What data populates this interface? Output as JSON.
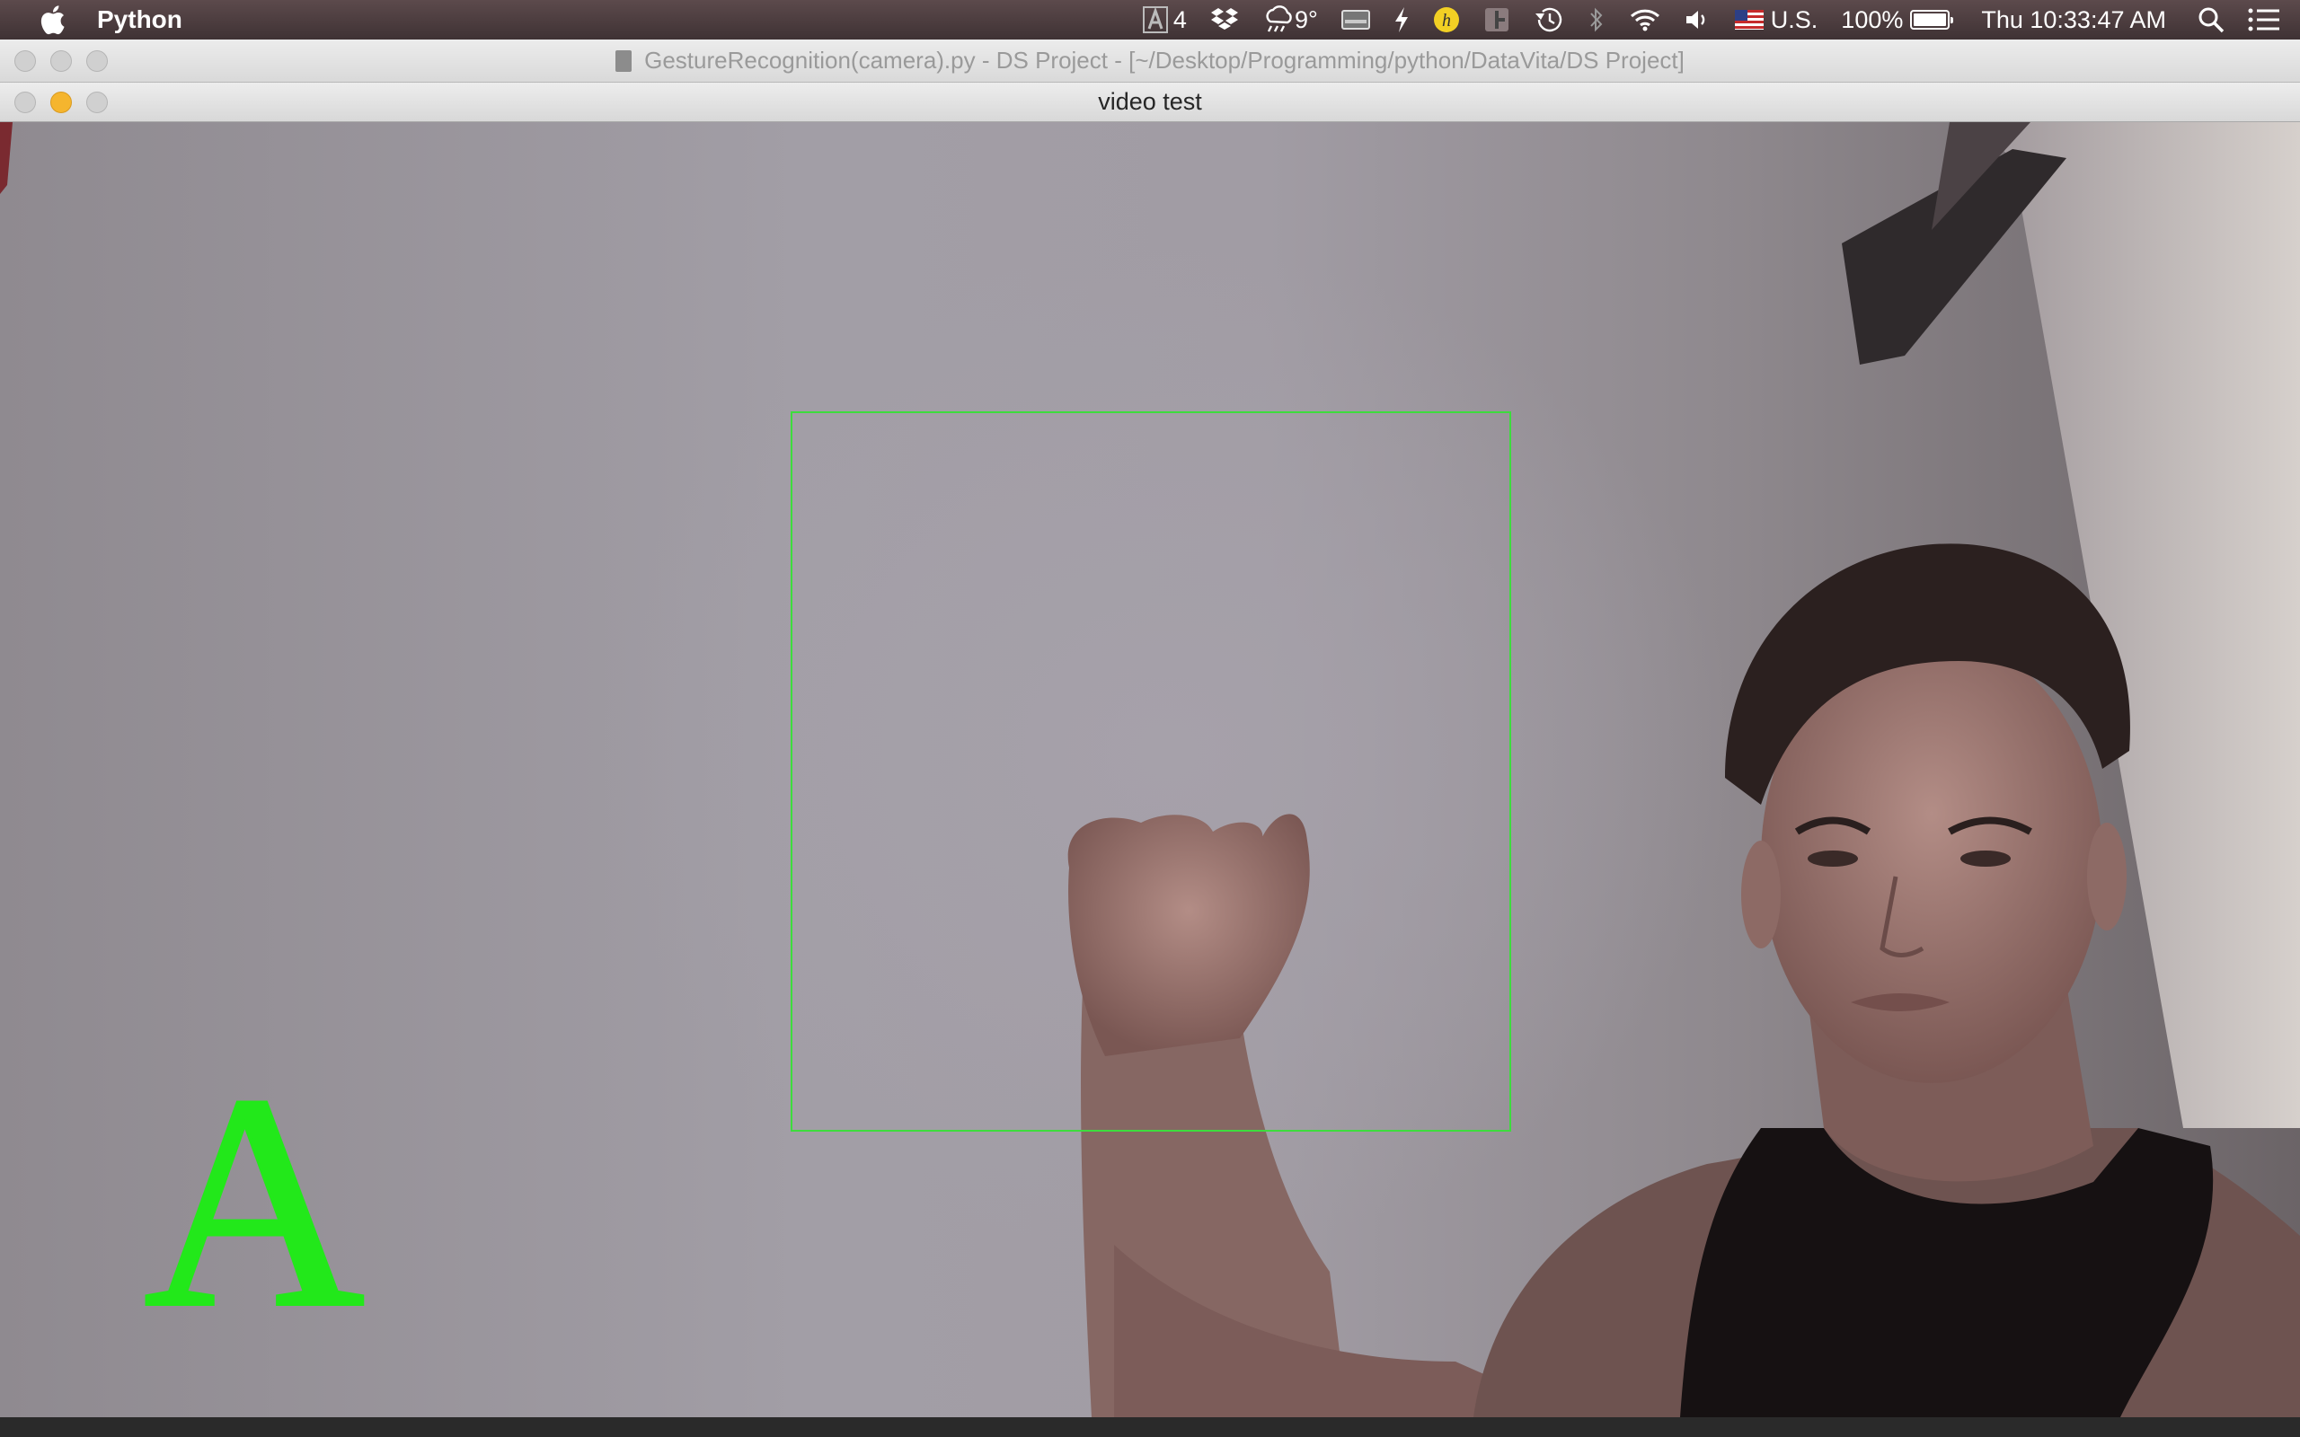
{
  "menubar": {
    "app_name": "Python",
    "adobe_count": "4",
    "temperature": "9°",
    "input_source": "U.S.",
    "battery": "100%",
    "clock": "Thu 10:33:47 AM",
    "icons": [
      "apple-icon",
      "adobe-icon",
      "dropbox-icon",
      "weather-icon",
      "menu-extra-icon",
      "flash-icon",
      "hazel-icon",
      "status-icon",
      "time-machine-icon",
      "bluetooth-icon",
      "wifi-icon",
      "volume-icon",
      "flag-icon",
      "battery-icon",
      "spotlight-icon",
      "notification-center-icon"
    ]
  },
  "ide_window": {
    "title": "GestureRecognition(camera).py - DS Project - [~/Desktop/Programming/python/DataVita/DS Project]"
  },
  "video_window": {
    "title": "video test",
    "detected_letter": "A",
    "roi_color": "#3ddc3d",
    "letter_color": "#22e81a"
  }
}
